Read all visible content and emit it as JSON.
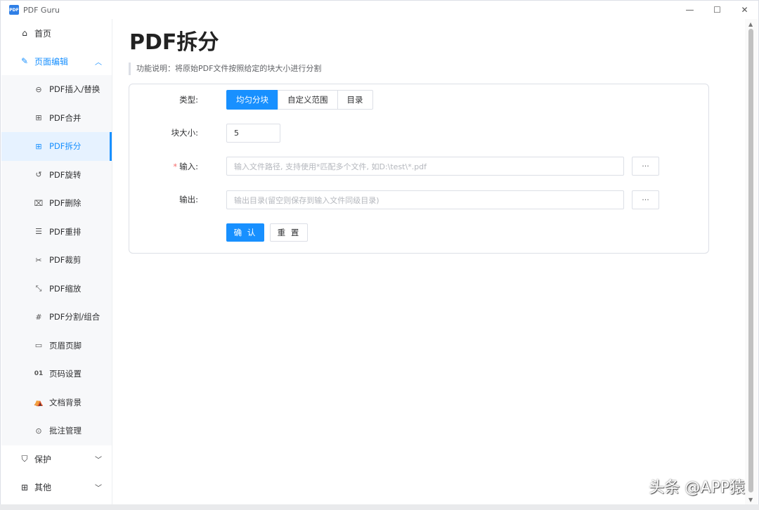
{
  "app": {
    "title": "PDF Guru",
    "logo_text": "PDF"
  },
  "window_controls": {
    "minimize": "—",
    "maximize": "☐",
    "close": "✕"
  },
  "sidebar": {
    "home": {
      "label": "首页",
      "icon": "home-icon"
    },
    "page_edit": {
      "label": "页面编辑",
      "icon": "edit-icon"
    },
    "sub_items": [
      {
        "label": "PDF插入/替换",
        "icon": "insert-icon",
        "glyph": "⊖"
      },
      {
        "label": "PDF合并",
        "icon": "merge-icon",
        "glyph": "⊞"
      },
      {
        "label": "PDF拆分",
        "icon": "split-icon",
        "glyph": "⊞"
      },
      {
        "label": "PDF旋转",
        "icon": "rotate-icon",
        "glyph": "↺"
      },
      {
        "label": "PDF删除",
        "icon": "trash-icon",
        "glyph": "🗑"
      },
      {
        "label": "PDF重排",
        "icon": "list-icon",
        "glyph": "☰"
      },
      {
        "label": "PDF裁剪",
        "icon": "scissors-icon",
        "glyph": "✂"
      },
      {
        "label": "PDF缩放",
        "icon": "shrink-icon",
        "glyph": "⤡"
      },
      {
        "label": "PDF分割/组合",
        "icon": "hash-icon",
        "glyph": "#"
      },
      {
        "label": "页眉页脚",
        "icon": "header-footer-icon",
        "glyph": "▭"
      },
      {
        "label": "页码设置",
        "icon": "page-number-icon",
        "glyph": "01"
      },
      {
        "label": "文档背景",
        "icon": "background-icon",
        "glyph": "⛾"
      },
      {
        "label": "批注管理",
        "icon": "comment-icon",
        "glyph": "◌"
      }
    ],
    "protect": {
      "label": "保护",
      "icon": "shield-icon"
    },
    "other": {
      "label": "其他",
      "icon": "grid-icon"
    }
  },
  "main": {
    "title": "PDF拆分",
    "description": "功能说明：将原始PDF文件按照给定的块大小进行分割",
    "form": {
      "type_label": "类型:",
      "type_options": [
        "均匀分块",
        "自定义范围",
        "目录"
      ],
      "type_selected": "均匀分块",
      "chunk_label": "块大小:",
      "chunk_value": "5",
      "input_label": "输入:",
      "input_required_mark": "*",
      "input_placeholder": "输入文件路径, 支持使用*匹配多个文件, 如D:\\test\\*.pdf",
      "output_label": "输出:",
      "output_placeholder": "输出目录(留空则保存到输入文件同级目录)",
      "browse_label": "···",
      "confirm_label": "确 认",
      "reset_label": "重 置"
    }
  },
  "watermark": "头条 @APP猿",
  "colors": {
    "accent": "#1890ff",
    "required": "#f56c6c",
    "border": "#dcdfe6"
  }
}
